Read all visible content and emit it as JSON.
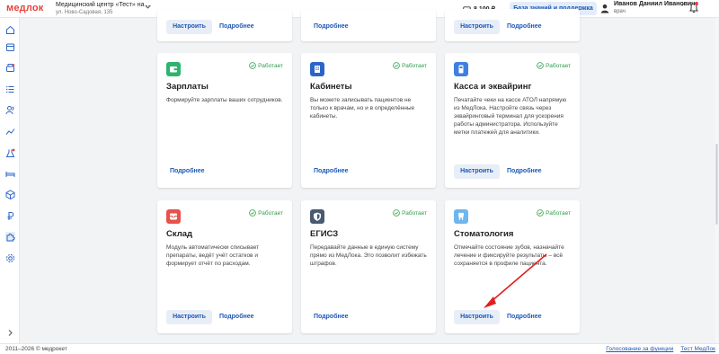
{
  "header": {
    "logo": "медлок",
    "clinic_name": "Медицинский центр «Тест» на ...",
    "clinic_address": "ул. Ново-Садовая, 135",
    "balance": "8 100 ₽",
    "knowledge_base": "База знаний и поддержка",
    "user_name": "Иванов Даниил Иванович",
    "user_role": "врач"
  },
  "sidebar": {
    "icons": [
      "home-icon",
      "calendar-icon",
      "cash-register-icon",
      "list-icon",
      "patients-icon",
      "analytics-icon",
      "lab-icon",
      "bed-icon",
      "warehouse-icon",
      "ruble-icon",
      "integrations-icon",
      "settings-icon",
      "expand-icon"
    ]
  },
  "cards": {
    "top_row": {
      "c1": {
        "set": "Настроить",
        "more": "Подробнее"
      },
      "c2": {
        "more": "Подробнее"
      },
      "c3": {
        "set": "Настроить",
        "more": "Подробнее"
      }
    },
    "salaries": {
      "title": "Зарплаты",
      "status": "Работает",
      "desc": "Формируйте зарплаты ваших сотрудников.",
      "more": "Подробнее",
      "icon": "wallet-icon",
      "icon_color": "#2fb36f"
    },
    "rooms": {
      "title": "Кабинеты",
      "status": "Работает",
      "desc": "Вы можете записывать пациентов не только к врачам, но и в определённые кабинеты.",
      "more": "Подробнее",
      "icon": "building-icon",
      "icon_color": "#2d64c8"
    },
    "kassa": {
      "title": "Касса и эквайринг",
      "status": "Работает",
      "desc": "Печатайте чеки на кассе АТОЛ напрямую из МедЛока. Настройте связь через эквайринговый терминал для ускорения работы администратора. Используйте метки платежей для аналитики.",
      "set": "Настроить",
      "more": "Подробнее",
      "icon": "terminal-icon",
      "icon_color": "#3f7fe0"
    },
    "warehouse": {
      "title": "Склад",
      "status": "Работает",
      "desc": "Модуль автоматически списывает препараты, ведёт учёт остатков и формирует отчёт по расходам.",
      "set": "Настроить",
      "more": "Подробнее",
      "icon": "box-icon",
      "icon_color": "#e8524a"
    },
    "egisz": {
      "title": "ЕГИСЗ",
      "status": "Работает",
      "desc": "Передавайте данные в единую систему прямо из МедЛока. Это позволит избежать штрафов.",
      "more": "Подробнее",
      "icon": "shield-icon",
      "icon_color": "#4a5a70"
    },
    "dental": {
      "title": "Стоматология",
      "status": "Работает",
      "desc": "Отмечайте состояние зубов, назначайте лечение и фиксируйте результаты – всё сохраняется в профиле пациента.",
      "set": "Настроить",
      "more": "Подробнее",
      "icon": "tooth-icon",
      "icon_color": "#6db6ef"
    }
  },
  "footer": {
    "copyright": "2011–2026 © медрокет",
    "link1": "Голосование за функции",
    "link2": "Тест МедЛок"
  },
  "colors": {
    "accent": "#1d58b5",
    "status_ok": "#2e9e48",
    "brand": "#e8413b",
    "arrow": "#e02020"
  }
}
